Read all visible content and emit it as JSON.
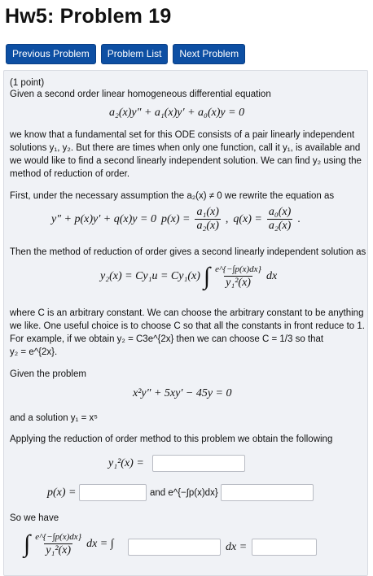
{
  "title": "Hw5: Problem 19",
  "nav": {
    "prev": "Previous Problem",
    "list": "Problem List",
    "next": "Next Problem"
  },
  "problem": {
    "points": "(1 point)",
    "intro": "Given a second order linear homogeneous differential equation",
    "eq_main": "a₂(x)y″ + a₁(x)y′ + a₀(x)y = 0",
    "p1_line1": "we know that a fundamental set for this ODE consists of a pair linearly independent",
    "p1_line2": "solutions y₁, y₂. But there are times when only one function, call it y₁, is available and",
    "p1_line3": "we would like to find a second linearly independent solution. We can find y₂ using the",
    "p1_line4": "method of reduction of order.",
    "p2": "First, under the necessary assumption the a₂(x) ≠ 0 we rewrite the equation as",
    "eq_rewrite_left": "y″ + p(x)y′ + q(x)y = 0",
    "p_label": "p(x) =",
    "p_num": "a₁(x)",
    "p_den": "a₂(x)",
    "q_label": "q(x) =",
    "q_num": "a₀(x)",
    "q_den": "a₂(x)",
    "p3": "Then the method of reduction of order gives a second linearly independent solution as",
    "eq_y2_left": "y₂(x) = Cy₁u = Cy₁(x)",
    "eq_y2_num": "e^{−∫p(x)dx}",
    "eq_y2_den": "y₁²(x)",
    "eq_y2_dx": "dx",
    "p4_line1": "where C is an arbitrary constant. We can choose the arbitrary constant to be anything",
    "p4_line2": "we like. One useful choice is to choose C so that all the constants in front reduce to 1.",
    "p4_line3": "For example, if we obtain y₂ = C3e^{2x} then we can choose C = 1/3 so that",
    "p4_line4": "y₂ = e^{2x}.",
    "given": "Given the problem",
    "eq_given": "x²y″ + 5xy′ − 45y = 0",
    "solution": "and a solution y₁ = x⁵",
    "applying": "Applying the reduction of order method to this problem we obtain the following",
    "y1sq_label": "y₁²(x) =",
    "px_label": "p(x) =",
    "and_label": "and e^{−∫p(x)dx} =",
    "so_we_have": "So we have",
    "int_num": "e^{−∫p(x)dx}",
    "int_den": "y₁²(x)",
    "int_mid": "dx = ∫",
    "int_end": "dx ="
  }
}
